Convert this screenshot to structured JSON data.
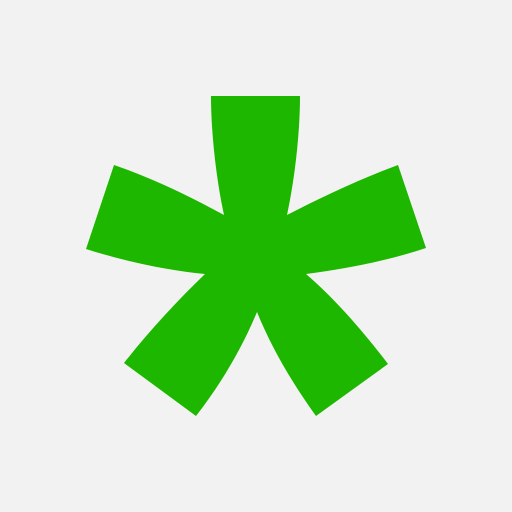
{
  "app": {
    "icon_name": "green-asterisk-icon"
  },
  "colors": {
    "background": "#f2f2f2",
    "icon": "#1eb700"
  }
}
